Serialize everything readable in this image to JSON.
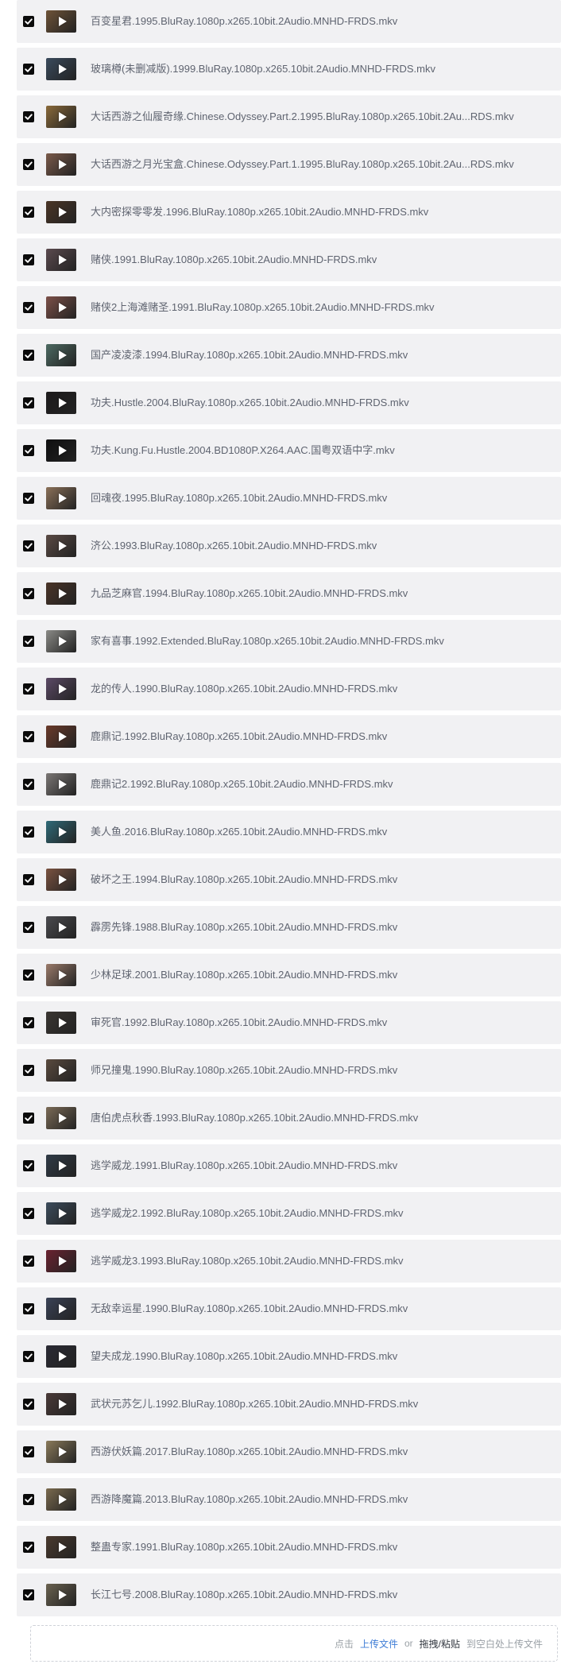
{
  "files": [
    {
      "name": "百变星君.1995.BluRay.1080p.x265.10bit.2Audio.MNHD-FRDS.mkv",
      "thumb": "#6e5338"
    },
    {
      "name": "玻璃樽(未删减版).1999.BluRay.1080p.x265.10bit.2Audio.MNHD-FRDS.mkv",
      "thumb": "#3a4a5c"
    },
    {
      "name": "大话西游之仙履奇缘.Chinese.Odyssey.Part.2.1995.BluRay.1080p.x265.10bit.2Au...RDS.mkv",
      "thumb": "#8a6a3a"
    },
    {
      "name": "大话西游之月光宝盒.Chinese.Odyssey.Part.1.1995.BluRay.1080p.x265.10bit.2Au...RDS.mkv",
      "thumb": "#7a5a4a"
    },
    {
      "name": "大内密探零零发.1996.BluRay.1080p.x265.10bit.2Audio.MNHD-FRDS.mkv",
      "thumb": "#4a3526"
    },
    {
      "name": "赌侠.1991.BluRay.1080p.x265.10bit.2Audio.MNHD-FRDS.mkv",
      "thumb": "#5b4a4e"
    },
    {
      "name": "赌侠2上海滩赌圣.1991.BluRay.1080p.x265.10bit.2Audio.MNHD-FRDS.mkv",
      "thumb": "#7c5048"
    },
    {
      "name": "国产凌凌漆.1994.BluRay.1080p.x265.10bit.2Audio.MNHD-FRDS.mkv",
      "thumb": "#4d6a62"
    },
    {
      "name": "功夫.Hustle.2004.BluRay.1080p.x265.10bit.2Audio.MNHD-FRDS.mkv",
      "thumb": "#1d1b1c"
    },
    {
      "name": "功夫.Kung.Fu.Hustle.2004.BD1080P.X264.AAC.国粤双语中字.mkv",
      "thumb": "#0f0f10"
    },
    {
      "name": "回魂夜.1995.BluRay.1080p.x265.10bit.2Audio.MNHD-FRDS.mkv",
      "thumb": "#8a7058"
    },
    {
      "name": "济公.1993.BluRay.1080p.x265.10bit.2Audio.MNHD-FRDS.mkv",
      "thumb": "#5a4a44"
    },
    {
      "name": "九品芝麻官.1994.BluRay.1080p.x265.10bit.2Audio.MNHD-FRDS.mkv",
      "thumb": "#4a3428"
    },
    {
      "name": "家有喜事.1992.Extended.BluRay.1080p.x265.10bit.2Audio.MNHD-FRDS.mkv",
      "thumb": "#8a8a86"
    },
    {
      "name": "龙的传人.1990.BluRay.1080p.x265.10bit.2Audio.MNHD-FRDS.mkv",
      "thumb": "#5c4a66"
    },
    {
      "name": "鹿鼎记.1992.BluRay.1080p.x265.10bit.2Audio.MNHD-FRDS.mkv",
      "thumb": "#6a3a2a"
    },
    {
      "name": "鹿鼎记2.1992.BluRay.1080p.x265.10bit.2Audio.MNHD-FRDS.mkv",
      "thumb": "#7a7674"
    },
    {
      "name": "美人鱼.2016.BluRay.1080p.x265.10bit.2Audio.MNHD-FRDS.mkv",
      "thumb": "#2f6a78"
    },
    {
      "name": "破坏之王.1994.BluRay.1080p.x265.10bit.2Audio.MNHD-FRDS.mkv",
      "thumb": "#7a5240"
    },
    {
      "name": "霹雳先锋.1988.BluRay.1080p.x265.10bit.2Audio.MNHD-FRDS.mkv",
      "thumb": "#4a4a4e"
    },
    {
      "name": "少林足球.2001.BluRay.1080p.x265.10bit.2Audio.MNHD-FRDS.mkv",
      "thumb": "#9a7a6a"
    },
    {
      "name": "审死官.1992.BluRay.1080p.x265.10bit.2Audio.MNHD-FRDS.mkv",
      "thumb": "#3a3632"
    },
    {
      "name": "师兄撞鬼.1990.BluRay.1080p.x265.10bit.2Audio.MNHD-FRDS.mkv",
      "thumb": "#5a4a3e"
    },
    {
      "name": "唐伯虎点秋香.1993.BluRay.1080p.x265.10bit.2Audio.MNHD-FRDS.mkv",
      "thumb": "#7a6a56"
    },
    {
      "name": "逃学威龙.1991.BluRay.1080p.x265.10bit.2Audio.MNHD-FRDS.mkv",
      "thumb": "#2f3a46"
    },
    {
      "name": "逃学威龙2.1992.BluRay.1080p.x265.10bit.2Audio.MNHD-FRDS.mkv",
      "thumb": "#3c4c5c"
    },
    {
      "name": "逃学威龙3.1993.BluRay.1080p.x265.10bit.2Audio.MNHD-FRDS.mkv",
      "thumb": "#6a2230"
    },
    {
      "name": "无敌幸运星.1990.BluRay.1080p.x265.10bit.2Audio.MNHD-FRDS.mkv",
      "thumb": "#3a4256"
    },
    {
      "name": "望夫成龙.1990.BluRay.1080p.x265.10bit.2Audio.MNHD-FRDS.mkv",
      "thumb": "#2a2a34"
    },
    {
      "name": "武状元苏乞儿.1992.BluRay.1080p.x265.10bit.2Audio.MNHD-FRDS.mkv",
      "thumb": "#4a3a38"
    },
    {
      "name": "西游伏妖篇.2017.BluRay.1080p.x265.10bit.2Audio.MNHD-FRDS.mkv",
      "thumb": "#8a7a5a"
    },
    {
      "name": "西游降魔篇.2013.BluRay.1080p.x265.10bit.2Audio.MNHD-FRDS.mkv",
      "thumb": "#7a6a4e"
    },
    {
      "name": "整蛊专家.1991.BluRay.1080p.x265.10bit.2Audio.MNHD-FRDS.mkv",
      "thumb": "#4a3a2e"
    },
    {
      "name": "长江七号.2008.BluRay.1080p.x265.10bit.2Audio.MNHD-FRDS.mkv",
      "thumb": "#6a6250"
    }
  ],
  "upload": {
    "click_text": "点击",
    "upload_link": "上传文件",
    "or_text": "or",
    "drag_text": "拖拽/粘贴",
    "hint_text": "到空白处上传文件"
  },
  "colors": {
    "row_bg": "#f1f1f3",
    "checkbox": "#0b0b0b",
    "link": "#3d7cd6"
  }
}
